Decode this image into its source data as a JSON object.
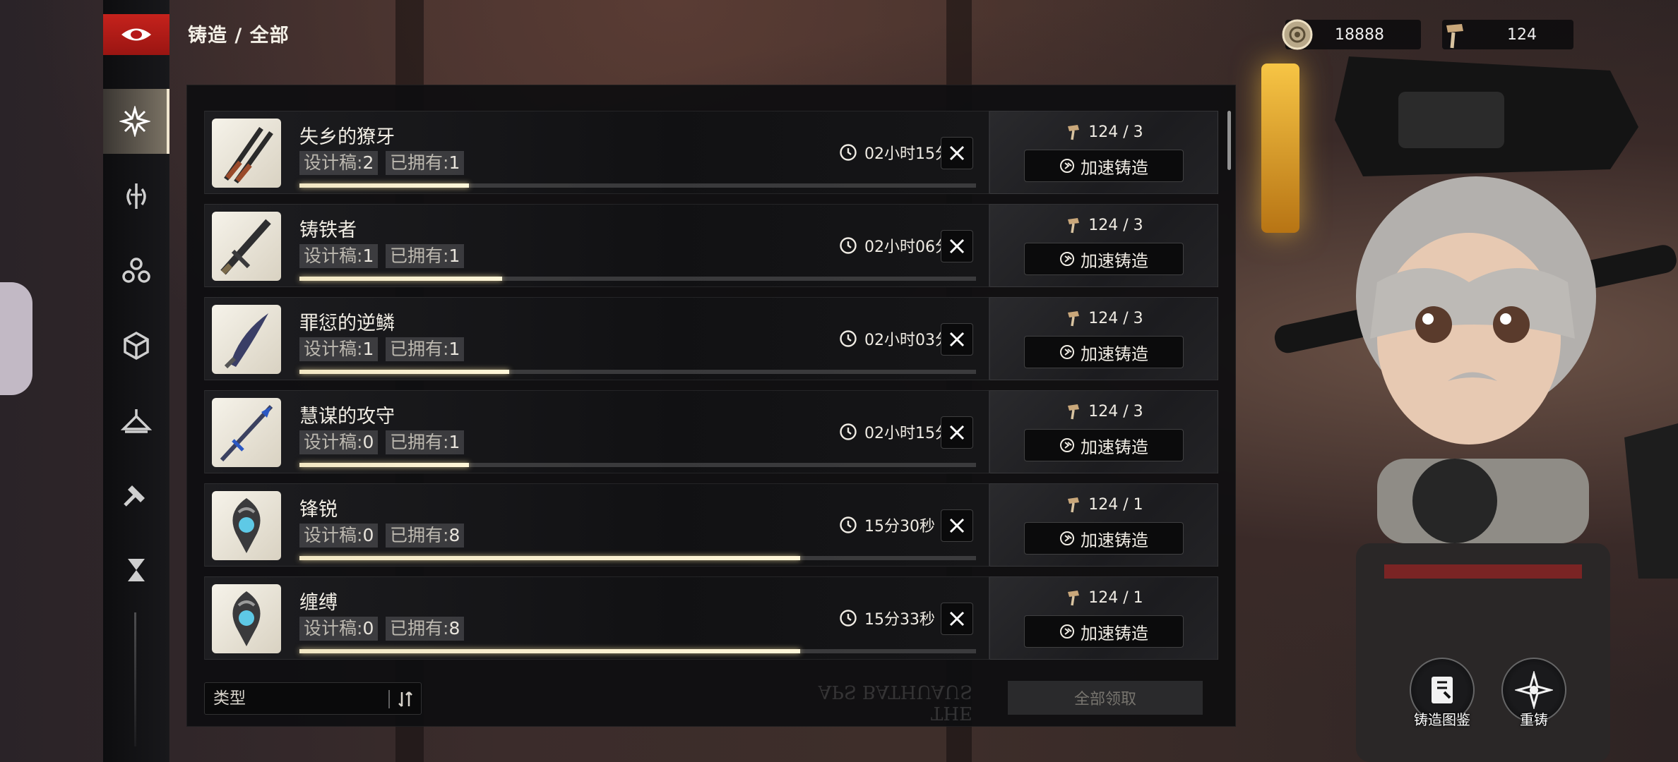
{
  "breadcrumb": "铸造 / 全部",
  "currencies": [
    {
      "icon": "coin-icon",
      "value": "18888"
    },
    {
      "icon": "hammer-icon",
      "value": "124"
    }
  ],
  "nav": [
    {
      "name": "forge-all",
      "icon": "shuriken-icon",
      "active": true
    },
    {
      "name": "forge-sword",
      "icon": "sword-shield-icon",
      "active": false
    },
    {
      "name": "forge-triad",
      "icon": "triad-icon",
      "active": false
    },
    {
      "name": "forge-cube",
      "icon": "cube-icon",
      "active": false
    },
    {
      "name": "forge-hanger",
      "icon": "hanger-icon",
      "active": false
    },
    {
      "name": "forge-hammer",
      "icon": "hammer-icon",
      "active": false
    },
    {
      "name": "forge-hourglass",
      "icon": "hourglass-icon",
      "active": false
    }
  ],
  "labels": {
    "design": "设计稿:",
    "owned": "已拥有:",
    "speed_up": "加速铸造",
    "type": "类型",
    "claim_all": "全部领取",
    "codex": "铸造图鉴",
    "reforge": "重铸",
    "stamp": "THE\nAPS BATHUAUS"
  },
  "items": [
    {
      "name": "失乡的獠牙",
      "design": "2",
      "owned": "1",
      "time": "02小时15分",
      "cost": "124 / 3",
      "progress": 0.25,
      "weapon": "twin-blades"
    },
    {
      "name": "铸铁者",
      "design": "1",
      "owned": "1",
      "time": "02小时06分",
      "cost": "124 / 3",
      "progress": 0.3,
      "weapon": "greatsword"
    },
    {
      "name": "罪愆的逆鳞",
      "design": "1",
      "owned": "1",
      "time": "02小时03分",
      "cost": "124 / 3",
      "progress": 0.31,
      "weapon": "curved-blade"
    },
    {
      "name": "慧谋的攻守",
      "design": "0",
      "owned": "1",
      "time": "02小时15分",
      "cost": "124 / 3",
      "progress": 0.25,
      "weapon": "spear"
    },
    {
      "name": "锋锐",
      "design": "0",
      "owned": "8",
      "time": "15分30秒",
      "cost": "124 / 1",
      "progress": 0.74,
      "weapon": "gem-charm"
    },
    {
      "name": "缠缚",
      "design": "0",
      "owned": "8",
      "time": "15分33秒",
      "cost": "124 / 1",
      "progress": 0.74,
      "weapon": "gem-charm"
    }
  ]
}
